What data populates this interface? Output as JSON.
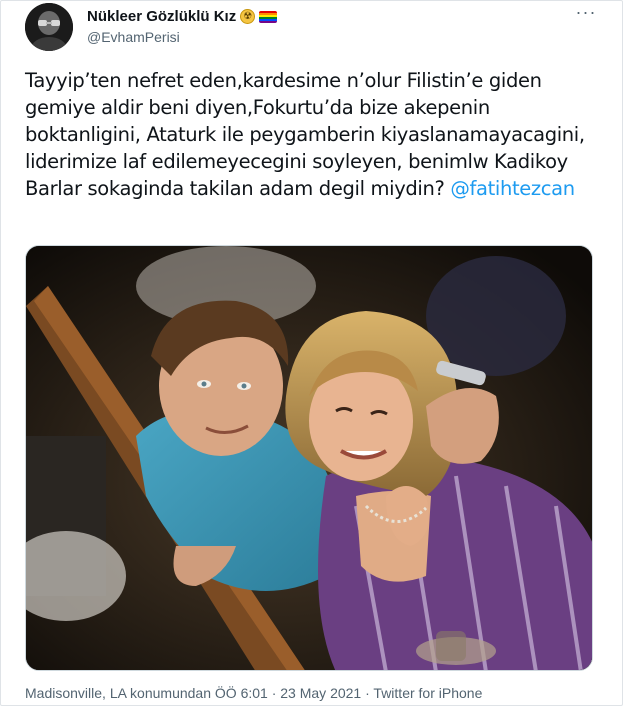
{
  "tweet": {
    "author": {
      "display_name": "Nükleer Gözlüklü Kız",
      "handle": "@EvhamPerisi",
      "badge_icons": [
        "radioactive-icon",
        "rainbow-flag-icon"
      ]
    },
    "more_icon": "more-options-icon",
    "text_before_mention": "Tayyip’ten nefret eden,kardesime n’olur Filistin’e giden gemiye aldir beni diyen,Fokurtu’da bize  akepenin boktanligini, Ataturk ile peygamberin kiyaslanamayacagini, liderimize laf edilemeyecegini soyleyen, benimlw Kadikoy Barlar sokaginda takilan adam degil miydin? ",
    "mention": "@fatihtezcan",
    "media": {
      "type": "photo"
    },
    "footer": {
      "location_time": "Madisonville, LA konumundan ÖÖ 6:01",
      "separator_1": " · ",
      "date": "23 May 2021",
      "separator_2": " · ",
      "source": "Twitter for iPhone"
    },
    "colors": {
      "text": "#0f1419",
      "secondary": "#536471",
      "link": "#1d9bf0",
      "border": "#cfd9de"
    }
  }
}
